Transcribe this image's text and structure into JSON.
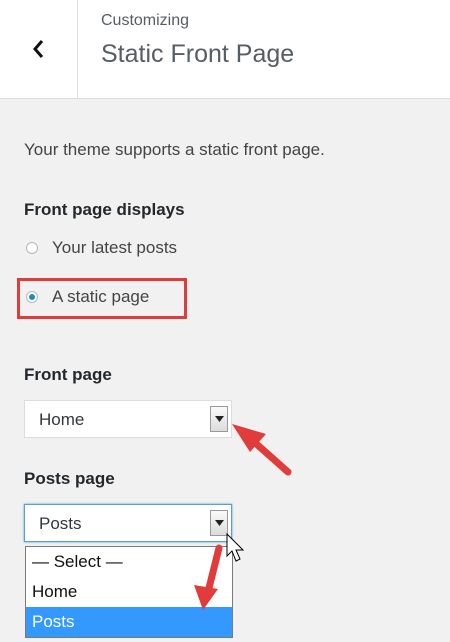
{
  "header": {
    "subtitle": "Customizing",
    "title": "Static Front Page",
    "back_icon": "chevron-left-icon"
  },
  "description": "Your theme supports a static front page.",
  "front_page_displays": {
    "label": "Front page displays",
    "options": [
      {
        "label": "Your latest posts",
        "checked": false
      },
      {
        "label": "A static page",
        "checked": true
      }
    ]
  },
  "front_page": {
    "label": "Front page",
    "value": "Home"
  },
  "posts_page": {
    "label": "Posts page",
    "value": "Posts",
    "options": [
      "— Select —",
      "Home",
      "Posts"
    ],
    "selected_option": "Posts"
  },
  "colors": {
    "annotation": "#e03c3c",
    "selection": "#3399ff",
    "radio_dot": "#1e8cbe"
  }
}
